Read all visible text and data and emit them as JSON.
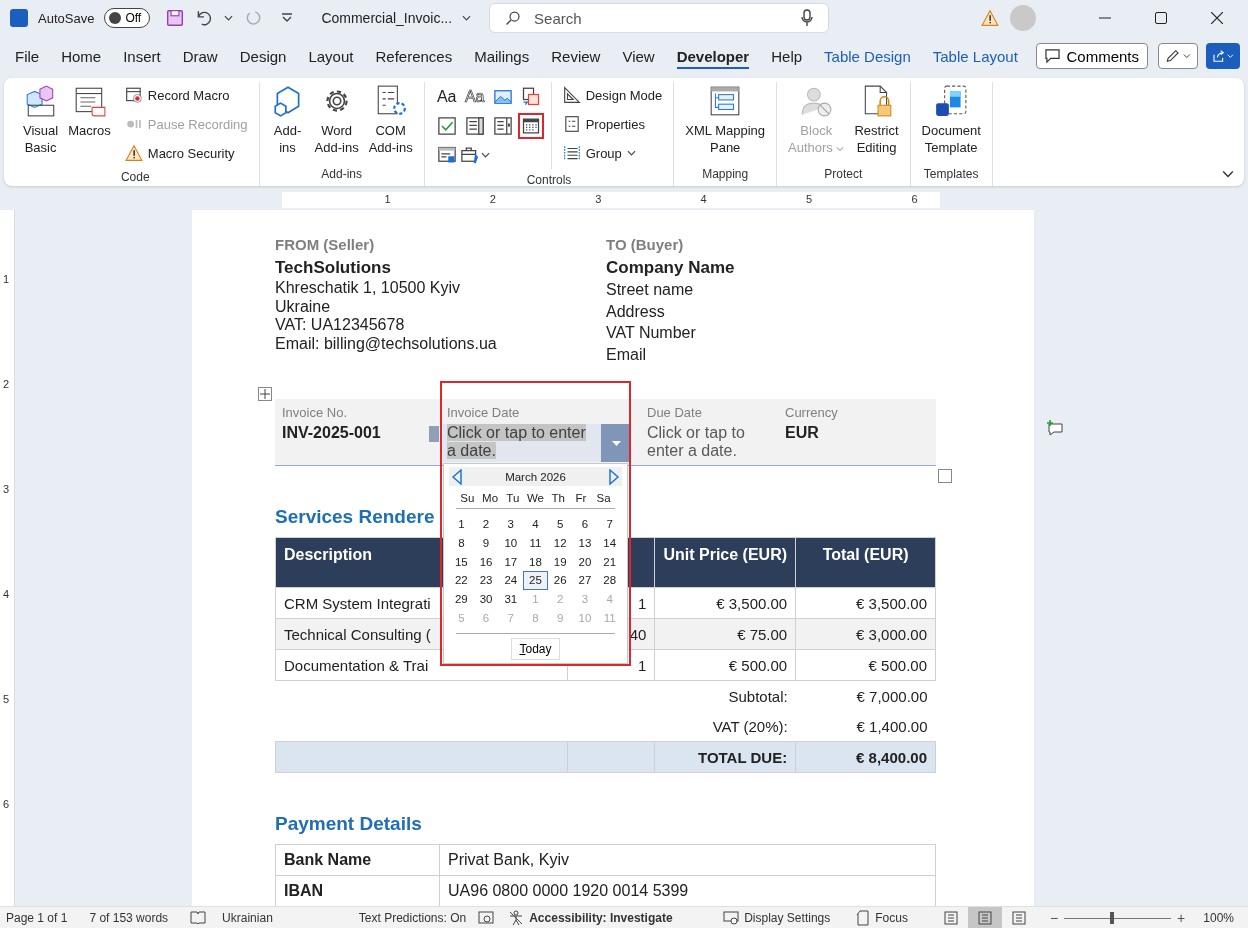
{
  "title_bar": {
    "autosave_label": "AutoSave",
    "autosave": {
      "on": false,
      "label": "Off"
    },
    "document_title": "Commercial_Invoic...",
    "search": {
      "placeholder": "Search"
    }
  },
  "menu_tabs": [
    {
      "label": "File",
      "kind": "normal",
      "selected": false
    },
    {
      "label": "Home",
      "kind": "normal",
      "selected": false
    },
    {
      "label": "Insert",
      "kind": "normal",
      "selected": false
    },
    {
      "label": "Draw",
      "kind": "normal",
      "selected": false
    },
    {
      "label": "Design",
      "kind": "normal",
      "selected": false
    },
    {
      "label": "Layout",
      "kind": "normal",
      "selected": false
    },
    {
      "label": "References",
      "kind": "normal",
      "selected": false
    },
    {
      "label": "Mailings",
      "kind": "normal",
      "selected": false
    },
    {
      "label": "Review",
      "kind": "normal",
      "selected": false
    },
    {
      "label": "View",
      "kind": "normal",
      "selected": false
    },
    {
      "label": "Developer",
      "kind": "normal",
      "selected": true
    },
    {
      "label": "Help",
      "kind": "normal",
      "selected": false
    },
    {
      "label": "Table Design",
      "kind": "contextual",
      "selected": false
    },
    {
      "label": "Table Layout",
      "kind": "contextual",
      "selected": false
    }
  ],
  "comments_button": "Comments",
  "ribbon": [
    {
      "label": "Code",
      "large": [
        {
          "lines": [
            "Visual",
            "Basic"
          ],
          "disabled": false
        },
        {
          "lines": [
            "Macros"
          ],
          "disabled": false
        }
      ],
      "small": [
        {
          "label": "Record Macro",
          "disabled": false
        },
        {
          "label": "Pause Recording",
          "disabled": true
        },
        {
          "label": "Macro Security",
          "disabled": false
        }
      ]
    },
    {
      "label": "Add-ins",
      "large": [
        {
          "lines": [
            "Add-",
            "ins"
          ],
          "disabled": false
        },
        {
          "lines": [
            "Word",
            "Add-ins"
          ],
          "disabled": false
        },
        {
          "lines": [
            "COM",
            "Add-ins"
          ],
          "disabled": false
        }
      ]
    },
    {
      "label": "Controls",
      "controls": [
        {
          "text": "Aa",
          "selected": false
        },
        {
          "text": "Aa",
          "selected": false
        },
        {
          "selected": false
        },
        {
          "selected": false
        },
        {
          "selected": false
        },
        {
          "selected": false
        },
        {
          "selected": false
        },
        {
          "selected": true
        },
        {
          "selected": false
        },
        {
          "selected": false,
          "dropdown": true
        }
      ],
      "small": [
        {
          "label": "Design Mode",
          "disabled": false
        },
        {
          "label": "Properties",
          "disabled": false
        },
        {
          "label": "Group",
          "disabled": false,
          "dropdown": true
        }
      ]
    },
    {
      "label": "Mapping",
      "large": [
        {
          "lines": [
            "XML Mapping",
            "Pane"
          ],
          "disabled": false
        }
      ]
    },
    {
      "label": "Protect",
      "large": [
        {
          "lines": [
            "Block",
            "Authors"
          ],
          "disabled": true,
          "dropdown": true
        },
        {
          "lines": [
            "Restrict",
            "Editing"
          ],
          "disabled": false
        }
      ]
    },
    {
      "label": "Templates",
      "large": [
        {
          "lines": [
            "Document",
            "Template"
          ],
          "disabled": false
        }
      ]
    }
  ],
  "ruler": {
    "marks": [
      "1",
      "2",
      "3",
      "4",
      "5",
      "6"
    ]
  },
  "vertical_ruler": {
    "marks": [
      "1",
      "2",
      "3",
      "4",
      "5",
      "6"
    ]
  },
  "seller": {
    "heading": "FROM (Seller)",
    "name": "TechSolutions",
    "lines": [
      "Khreschatik 1, 10500 Kyiv",
      "Ukraine",
      "VAT: UA12345678",
      "Email: billing@techsolutions.ua"
    ]
  },
  "buyer": {
    "heading": "TO (Buyer)",
    "name": "Company Name",
    "lines": [
      "Street name",
      "Address",
      "VAT Number",
      "Email"
    ]
  },
  "invoice_fields": [
    {
      "label": "Invoice No.",
      "value": "INV-2025-001",
      "kind": "text"
    },
    {
      "label": "Invoice Date",
      "value": "Click or tap to enter a date.",
      "kind": "date"
    },
    {
      "label": "Due Date",
      "value": "Click or tap to enter a date.",
      "kind": "placeholder"
    },
    {
      "label": "Currency",
      "value": "EUR",
      "kind": "text"
    }
  ],
  "calendar": {
    "month": "March 2026",
    "weekdays": [
      "Su",
      "Mo",
      "Tu",
      "We",
      "Th",
      "Fr",
      "Sa"
    ],
    "weeks": [
      [
        {
          "day": "1",
          "muted": false,
          "selected": false
        },
        {
          "day": "2",
          "muted": false,
          "selected": false
        },
        {
          "day": "3",
          "muted": false,
          "selected": false
        },
        {
          "day": "4",
          "muted": false,
          "selected": false
        },
        {
          "day": "5",
          "muted": false,
          "selected": false
        },
        {
          "day": "6",
          "muted": false,
          "selected": false
        },
        {
          "day": "7",
          "muted": false,
          "selected": false
        }
      ],
      [
        {
          "day": "8",
          "muted": false,
          "selected": false
        },
        {
          "day": "9",
          "muted": false,
          "selected": false
        },
        {
          "day": "10",
          "muted": false,
          "selected": false
        },
        {
          "day": "11",
          "muted": false,
          "selected": false
        },
        {
          "day": "12",
          "muted": false,
          "selected": false
        },
        {
          "day": "13",
          "muted": false,
          "selected": false
        },
        {
          "day": "14",
          "muted": false,
          "selected": false
        }
      ],
      [
        {
          "day": "15",
          "muted": false,
          "selected": false
        },
        {
          "day": "16",
          "muted": false,
          "selected": false
        },
        {
          "day": "17",
          "muted": false,
          "selected": false
        },
        {
          "day": "18",
          "muted": false,
          "selected": false
        },
        {
          "day": "19",
          "muted": false,
          "selected": false
        },
        {
          "day": "20",
          "muted": false,
          "selected": false
        },
        {
          "day": "21",
          "muted": false,
          "selected": false
        }
      ],
      [
        {
          "day": "22",
          "muted": false,
          "selected": false
        },
        {
          "day": "23",
          "muted": false,
          "selected": false
        },
        {
          "day": "24",
          "muted": false,
          "selected": false
        },
        {
          "day": "25",
          "muted": false,
          "selected": true
        },
        {
          "day": "26",
          "muted": false,
          "selected": false
        },
        {
          "day": "27",
          "muted": false,
          "selected": false
        },
        {
          "day": "28",
          "muted": false,
          "selected": false
        }
      ],
      [
        {
          "day": "29",
          "muted": false,
          "selected": false
        },
        {
          "day": "30",
          "muted": false,
          "selected": false
        },
        {
          "day": "31",
          "muted": false,
          "selected": false
        },
        {
          "day": "1",
          "muted": true,
          "selected": false
        },
        {
          "day": "2",
          "muted": true,
          "selected": false
        },
        {
          "day": "3",
          "muted": true,
          "selected": false
        },
        {
          "day": "4",
          "muted": true,
          "selected": false
        }
      ],
      [
        {
          "day": "5",
          "muted": true,
          "selected": false
        },
        {
          "day": "6",
          "muted": true,
          "selected": false
        },
        {
          "day": "7",
          "muted": true,
          "selected": false
        },
        {
          "day": "8",
          "muted": true,
          "selected": false
        },
        {
          "day": "9",
          "muted": true,
          "selected": false
        },
        {
          "day": "10",
          "muted": true,
          "selected": false
        },
        {
          "day": "11",
          "muted": true,
          "selected": false
        }
      ]
    ],
    "today_button": "Today"
  },
  "services": {
    "heading": "Services Rendere",
    "columns": [
      "Description",
      "",
      "Unit Price (EUR)",
      "Total (EUR)"
    ],
    "rows": [
      {
        "cells": [
          "CRM System Integrati",
          "1",
          "€ 3,500.00",
          "€ 3,500.00"
        ]
      },
      {
        "cells": [
          "Technical Consulting (",
          "40",
          "€ 75.00",
          "€ 3,000.00"
        ]
      },
      {
        "cells": [
          "Documentation & Trai",
          "1",
          "€ 500.00",
          "€ 500.00"
        ]
      }
    ],
    "totals": [
      {
        "label": "Subtotal:",
        "value": "€ 7,000.00",
        "kind": "plain"
      },
      {
        "label": "VAT (20%):",
        "value": "€ 1,400.00",
        "kind": "plain"
      },
      {
        "label": "TOTAL DUE:",
        "value": "€ 8,400.00",
        "kind": "grand"
      }
    ]
  },
  "payment": {
    "heading": "Payment Details",
    "rows": [
      {
        "label": "Bank Name",
        "value": "Privat Bank, Kyiv"
      },
      {
        "label": "IBAN",
        "value": "UA96 0800 0000 1920 0014 5399"
      }
    ]
  },
  "status_bar": {
    "page": "Page 1 of 1",
    "words": "7 of 153 words",
    "language": "Ukrainian",
    "predictions": "Text Predictions: On",
    "accessibility": "Accessibility: Investigate",
    "display_settings": "Display Settings",
    "focus": "Focus",
    "views": [
      {
        "selected": false
      },
      {
        "selected": true
      },
      {
        "selected": false
      }
    ],
    "zoom": {
      "minus": "−",
      "plus": "+",
      "level": 0.43,
      "label": "100%"
    }
  }
}
